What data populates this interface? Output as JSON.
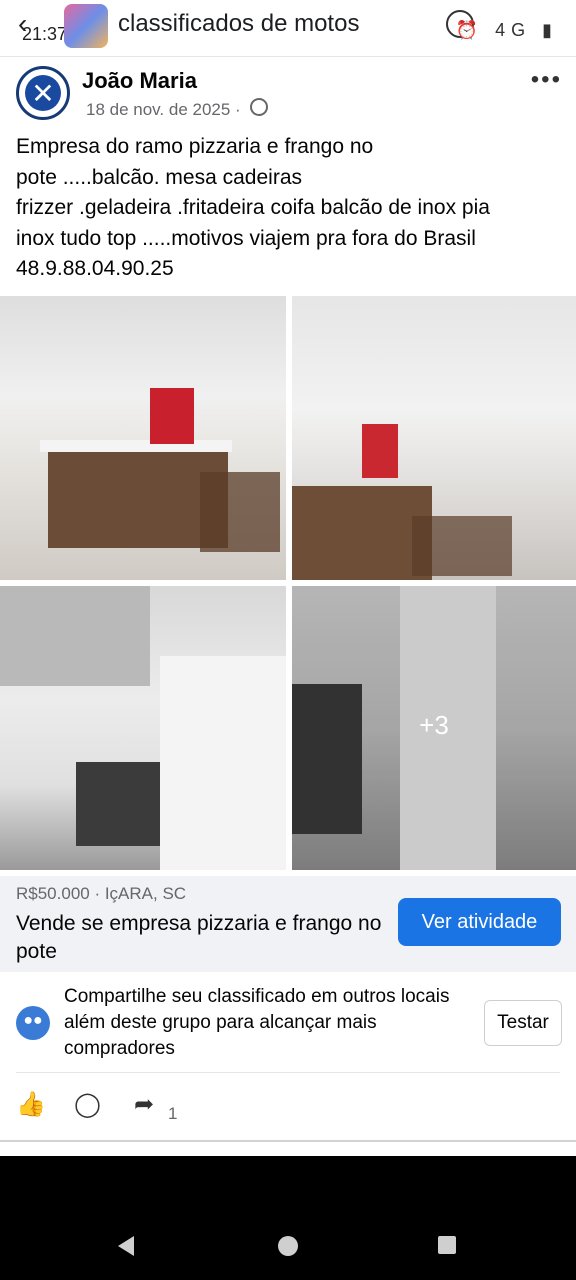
{
  "status_bar": {
    "time": "21:37",
    "group_title": "classificados de motos",
    "network": "4G"
  },
  "post": {
    "author": "João Maria",
    "date": "18 de nov. de 2025 ·",
    "text": "Empresa  do ramo pizzaria e frango no\npote .....balcão. mesa cadeiras\nfrizzer .geladeira .fritadeira coifa balcão de inox pia\ninox tudo top .....motivos viajem pra fora do Brasil\n48.9.88.04.90.25",
    "more_photos": "+3"
  },
  "listing": {
    "price_location": "R$50.000 · IçARA, SC",
    "title": "Vende se empresa pizzaria e frango no pote",
    "action_label": "Ver atividade"
  },
  "share_prompt": {
    "text": "Compartilhe seu classificado em outros locais além deste grupo para alcançar mais compradores",
    "button_label": "Testar"
  },
  "actions": {
    "share_count": "1"
  },
  "icons": {
    "back": "back-arrow-icon",
    "privacy": "globe-icon",
    "menu": "more-icon",
    "group": "people-icon",
    "like": "thumbs-up-icon",
    "comment": "comment-icon",
    "share": "share-icon"
  },
  "colors": {
    "accent": "#1b74e4",
    "listing_bg": "#f0f2f5"
  }
}
